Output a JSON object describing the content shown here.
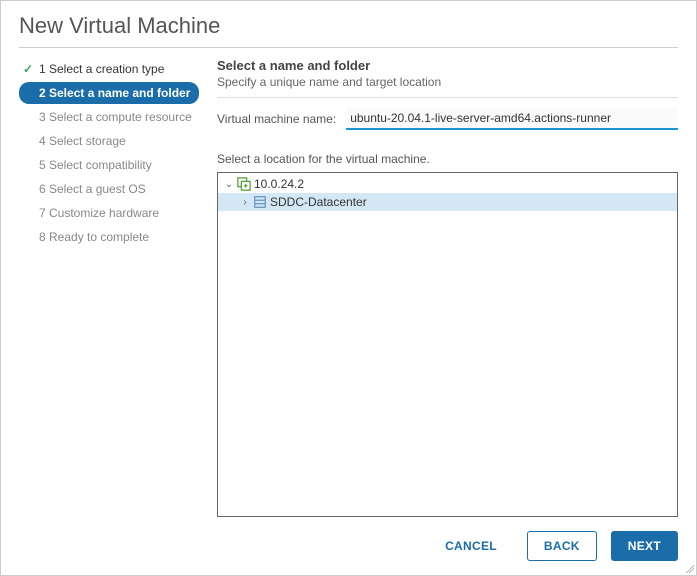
{
  "dialog": {
    "title": "New Virtual Machine"
  },
  "steps": [
    {
      "label": "1 Select a creation type",
      "state": "completed"
    },
    {
      "label": "2 Select a name and folder",
      "state": "active"
    },
    {
      "label": "3 Select a compute resource",
      "state": "pending"
    },
    {
      "label": "4 Select storage",
      "state": "pending"
    },
    {
      "label": "5 Select compatibility",
      "state": "pending"
    },
    {
      "label": "6 Select a guest OS",
      "state": "pending"
    },
    {
      "label": "7 Customize hardware",
      "state": "pending"
    },
    {
      "label": "8 Ready to complete",
      "state": "pending"
    }
  ],
  "panel": {
    "heading": "Select a name and folder",
    "subheading": "Specify a unique name and target location",
    "name_field_label": "Virtual machine name:",
    "name_field_value": "ubuntu-20.04.1-live-server-amd64.actions-runner",
    "location_label": "Select a location for the virtual machine."
  },
  "tree": {
    "root": {
      "label": "10.0.24.2",
      "expanded": true
    },
    "child": {
      "label": "SDDC-Datacenter",
      "expanded": false,
      "selected": true
    }
  },
  "footer": {
    "cancel": "CANCEL",
    "back": "BACK",
    "next": "NEXT"
  }
}
